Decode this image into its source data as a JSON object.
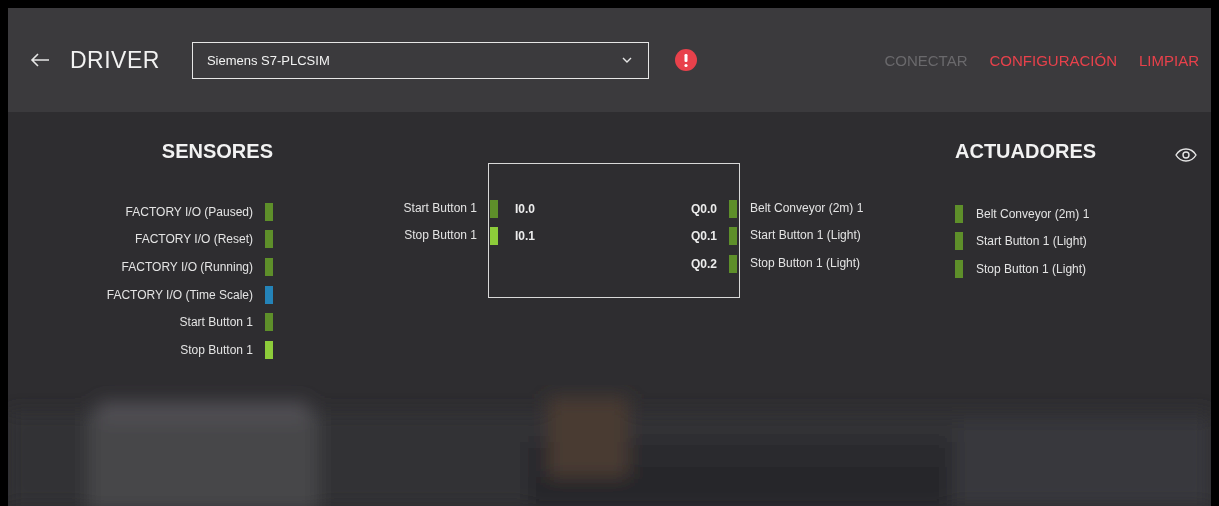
{
  "header": {
    "title": "DRIVER",
    "driver_select": {
      "value": "Siemens S7-PLCSIM"
    },
    "error": true,
    "actions": [
      {
        "label": "CONECTAR",
        "disabled": true
      },
      {
        "label": "CONFIGURACIÓN",
        "disabled": false
      },
      {
        "label": "LIMPIAR",
        "disabled": false
      }
    ]
  },
  "sensors": {
    "title": "SENSORES",
    "items": [
      {
        "label": "FACTORY I/O (Paused)",
        "kind": "bool",
        "on": false
      },
      {
        "label": "FACTORY I/O (Reset)",
        "kind": "bool",
        "on": false
      },
      {
        "label": "FACTORY I/O (Running)",
        "kind": "bool",
        "on": false
      },
      {
        "label": "FACTORY I/O (Time Scale)",
        "kind": "float",
        "on": false
      },
      {
        "label": "Start Button 1",
        "kind": "bool",
        "on": false
      },
      {
        "label": "Stop Button 1",
        "kind": "bool",
        "on": true
      }
    ]
  },
  "mapping": {
    "inputs": [
      {
        "label": "Start Button 1",
        "address": "I0.0",
        "on": false
      },
      {
        "label": "Stop Button 1",
        "address": "I0.1",
        "on": true
      }
    ],
    "outputs": [
      {
        "address": "Q0.0",
        "label": "Belt Conveyor (2m) 1",
        "on": false
      },
      {
        "address": "Q0.1",
        "label": "Start Button 1 (Light)",
        "on": false
      },
      {
        "address": "Q0.2",
        "label": "Stop Button 1 (Light)",
        "on": false
      }
    ]
  },
  "actuators": {
    "title": "ACTUADORES",
    "items": [
      {
        "label": "Belt Conveyor (2m) 1",
        "on": false
      },
      {
        "label": "Start Button 1 (Light)",
        "on": false
      },
      {
        "label": "Stop Button 1 (Light)",
        "on": false
      }
    ]
  }
}
